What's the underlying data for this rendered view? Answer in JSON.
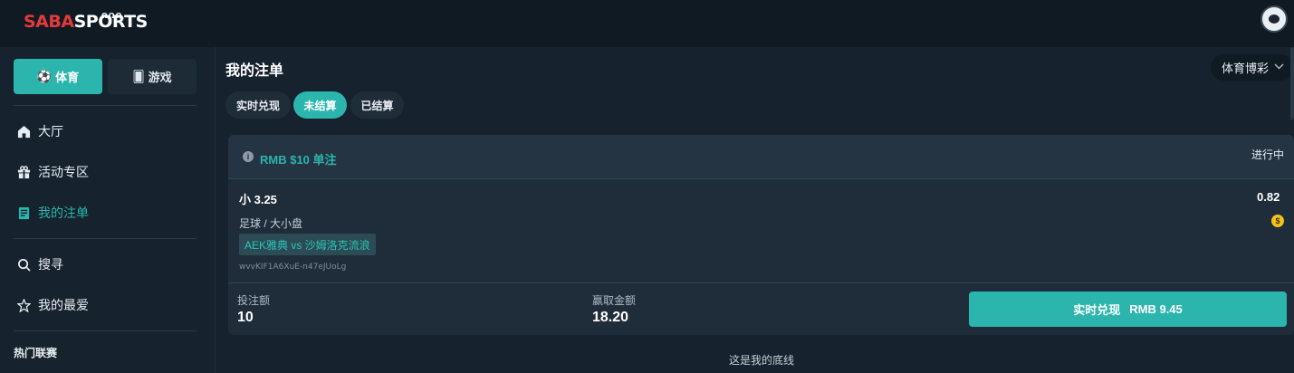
{
  "header": {
    "logo_part1": "SABA",
    "logo_part2": "SPORTS",
    "logo_crown": "ΩΩΩ"
  },
  "sidebar": {
    "modes": [
      {
        "label": "体育",
        "icon": "soccer-ball-icon",
        "active": true
      },
      {
        "label": "游戏",
        "icon": "cards-icon",
        "active": false
      }
    ],
    "nav": [
      {
        "label": "大厅",
        "icon": "home-icon"
      },
      {
        "label": "活动专区",
        "icon": "gift-icon"
      },
      {
        "label": "我的注单",
        "icon": "bet-slip-icon",
        "active": true
      },
      {
        "label": "搜寻",
        "icon": "search-icon"
      },
      {
        "label": "我的最爱",
        "icon": "star-icon"
      }
    ],
    "section_label": "热门联赛"
  },
  "main": {
    "title": "我的注单",
    "type_select": "体育博彩",
    "tabs": [
      {
        "label": "实时兑现",
        "active": false
      },
      {
        "label": "未结算",
        "active": true
      },
      {
        "label": "已结算",
        "active": false
      }
    ],
    "bet": {
      "header": "RMB $10 单注",
      "status": "进行中",
      "pick": "小  3.25",
      "odds": "0.82",
      "market": "足球 / 大小盘",
      "match": "AEK雅典 vs 沙姆洛克流浪",
      "bet_id": "wvvKIF1A6XuE-n47eJUoLg",
      "stake_label": "投注额",
      "stake_value": "10",
      "win_label": "赢取金额",
      "win_value": "18.20",
      "cashout_label": "实时兑现",
      "cashout_amount": "RMB 9.45"
    },
    "footer_note": "这是我的底线"
  },
  "colors": {
    "accent": "#2bb5ad",
    "background": "#16222d",
    "card": "#1f2d3a",
    "logo_red": "#e23a3a",
    "coin": "#f2c318"
  }
}
